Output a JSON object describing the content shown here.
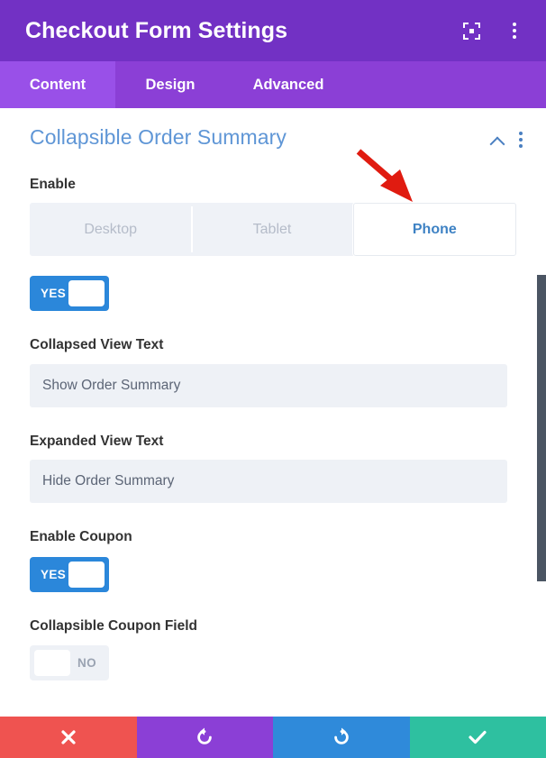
{
  "window": {
    "title": "Checkout Form Settings",
    "actions": [
      {
        "name": "expand-view-icon",
        "glyph": "fullscreen"
      },
      {
        "name": "more-options-icon",
        "glyph": "kebab"
      }
    ]
  },
  "tabs": [
    {
      "label": "Content",
      "active": true
    },
    {
      "label": "Design",
      "active": false
    },
    {
      "label": "Advanced",
      "active": false
    }
  ],
  "section": {
    "title": "Collapsible Order Summary",
    "collapse_icon": "chevron-up-icon",
    "menu_icon": "kebab-menu-icon"
  },
  "fields": {
    "enable": {
      "label": "Enable",
      "device_tabs": [
        {
          "label": "Desktop",
          "selected": false
        },
        {
          "label": "Tablet",
          "selected": false
        },
        {
          "label": "Phone",
          "selected": true
        }
      ],
      "toggle": {
        "state": "on",
        "label": "YES"
      }
    },
    "collapsed_view_text": {
      "label": "Collapsed View Text",
      "value": "Show Order Summary",
      "placeholder": "Show Order Summary"
    },
    "expanded_view_text": {
      "label": "Expanded View Text",
      "value": "Hide Order Summary",
      "placeholder": "Hide Order Summary"
    },
    "enable_coupon": {
      "label": "Enable Coupon",
      "toggle": {
        "state": "on",
        "label": "YES"
      }
    },
    "collapsible_coupon_field": {
      "label": "Collapsible Coupon Field",
      "toggle": {
        "state": "off",
        "label": "NO"
      }
    }
  },
  "actionbar": [
    {
      "name": "cancel-button",
      "icon": "close-icon",
      "color": "#ef5350"
    },
    {
      "name": "undo-button",
      "icon": "undo-icon",
      "color": "#8b3fd6"
    },
    {
      "name": "redo-button",
      "icon": "redo-icon",
      "color": "#2f8ada"
    },
    {
      "name": "save-button",
      "icon": "check-icon",
      "color": "#2ec0a0"
    }
  ],
  "annotation": {
    "type": "arrow",
    "color": "#e01b10",
    "points_to": "phone-device-tab"
  },
  "colors": {
    "titlebar": "#7231c4",
    "tabbar": "#8b3fd6",
    "tab_active": "#9950e8",
    "section_title": "#5f96d6",
    "toggle_on": "#2b87da",
    "toggle_off": "#eef1f6",
    "input_bg": "#eef1f6",
    "scrollbar": "#4b5563"
  },
  "scrollbar": {
    "name": "vertical-scrollbar",
    "position": "right"
  }
}
